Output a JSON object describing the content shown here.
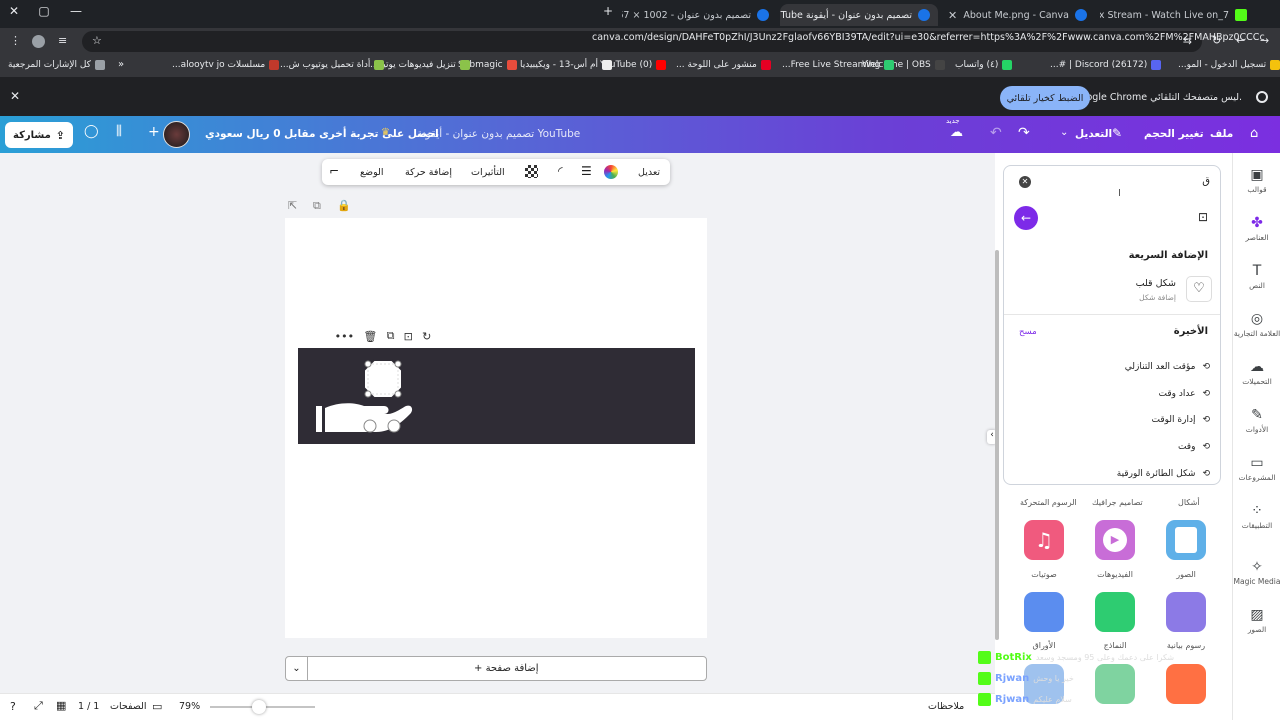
{
  "tabs": [
    {
      "title": "7_Nyx Stream - Watch Live on",
      "favicon_color": "#53fc18",
      "active": false
    },
    {
      "title": "About Me.png - Canva",
      "favicon_color": "#1a73e8",
      "active": false
    },
    {
      "title": "تصميم بدون عنوان - أيقونة YouTube",
      "favicon_color": "#1a73e8",
      "active": true
    },
    {
      "title": "تصميم بدون عنوان - 1002 × 67",
      "favicon_color": "#1a73e8",
      "active": false
    }
  ],
  "address": {
    "url": "canva.com/design/DAHFeT0pZhI/J3Unz2Fglaofv66YBI39TA/edit?ui=e30&referrer=https%3A%2F%2Fwww.canva.com%2FM%2FMAHBpz0CCCc"
  },
  "bookmarks": [
    {
      "label": "تسجيل الدخول - المو...",
      "color": "#f4c20d"
    },
    {
      "label": "(26172) Discord | #...",
      "color": "#5865f2"
    },
    {
      "label": "(٤) واتساب",
      "color": "#25d366"
    },
    {
      "label": "Welcome | OBS",
      "color": "#444"
    },
    {
      "label": "Free Live Streaming...",
      "color": "#2ecc71"
    },
    {
      "label": "منشور على اللوحة ...",
      "color": "#e60023"
    },
    {
      "label": "YouTube (0)",
      "color": "#ff0000"
    },
    {
      "label": "أم أس-13 - ويكيبيديا",
      "color": "#eee"
    },
    {
      "label": "Submagic",
      "color": "#e74c3c"
    },
    {
      "label": "تنزيل فيديوهات يوتيو...",
      "color": "#8bc34a"
    },
    {
      "label": "أداة تحميل يوتيوب ش...",
      "color": "#8bc34a"
    },
    {
      "label": "مسلسلات alooytv jo...",
      "color": "#c0392b"
    },
    {
      "label": "كل الإشارات المرجعية",
      "color": "#9aa0a6"
    }
  ],
  "infobar": {
    "text": "Google Chrome ليس متصفحك التلقائي.",
    "button": "الضبط كخيار تلقائي"
  },
  "header": {
    "file": "ملف",
    "resize": "تغيير الحجم",
    "edit": "التعديل",
    "new_badge": "جديد",
    "doc_title": "تصميم بدون عنوان - أيقونة YouTube",
    "promo": "احصل على تجربة أخرى مقابل 0 ريال سعودي",
    "share": "مشاركة"
  },
  "rail": [
    {
      "label": "قوالب",
      "icon": "template-icon"
    },
    {
      "label": "العناصر",
      "icon": "elements-icon"
    },
    {
      "label": "النص",
      "icon": "text-icon"
    },
    {
      "label": "العلامة التجارية",
      "icon": "brand-icon"
    },
    {
      "label": "التحميلات",
      "icon": "upload-icon"
    },
    {
      "label": "الأدوات",
      "icon": "tools-icon"
    },
    {
      "label": "المشروعات",
      "icon": "folder-icon"
    },
    {
      "label": "التطبيقات",
      "icon": "apps-icon"
    },
    {
      "label": "Magic Media",
      "icon": "magic-media-icon"
    },
    {
      "label": "الصور",
      "icon": "photos-icon"
    }
  ],
  "panel": {
    "search_value": "ق",
    "quick_add_title": "الإضافة السريعة",
    "quick_item_title": "شكل قلب",
    "quick_item_sub": "إضافة شكل",
    "recent_title": "الأخيرة",
    "clear": "مسح",
    "recent": [
      "مؤقت العد التنازلي",
      "عداد وقت",
      "إدارة الوقت",
      "وقت",
      "شكل الطائرة الورقية"
    ],
    "grid_headers": [
      "أشكال",
      "تصاميم جرافيك",
      "الرسوم المتحركة"
    ],
    "grid": [
      {
        "label": "الصور",
        "color": "#5fb0e8"
      },
      {
        "label": "الفيديوهات",
        "color": "#c86dd7"
      },
      {
        "label": "صوتيات",
        "color": "#f05a7e"
      },
      {
        "label": "رسوم بيانية",
        "color": "#8c7ae6"
      },
      {
        "label": "النماذج",
        "color": "#2ecc71"
      },
      {
        "label": "الأوراق",
        "color": "#5b8def"
      }
    ]
  },
  "toolbar": {
    "edit": "تعديل",
    "effects": "التأثيرات",
    "animate": "إضافة حركة",
    "position": "الوضع"
  },
  "canvas": {
    "add_page": "+ إضافة صفحة"
  },
  "bottom": {
    "notes": "ملاحظات",
    "zoom": "79%",
    "pages_label": "الصفحات",
    "pages": "1 / 1"
  },
  "overlay_chat": [
    {
      "name": "BotRix",
      "text": "شكرا على دعمك وعلى 95 ومسجد وسعد",
      "color": "#53fc18"
    },
    {
      "name": "Rjwan",
      "text": "خير يا وحش",
      "color": "#7aa2ff"
    },
    {
      "name": "Rjwan",
      "text": "سلام عليكم",
      "color": "#7aa2ff"
    }
  ]
}
